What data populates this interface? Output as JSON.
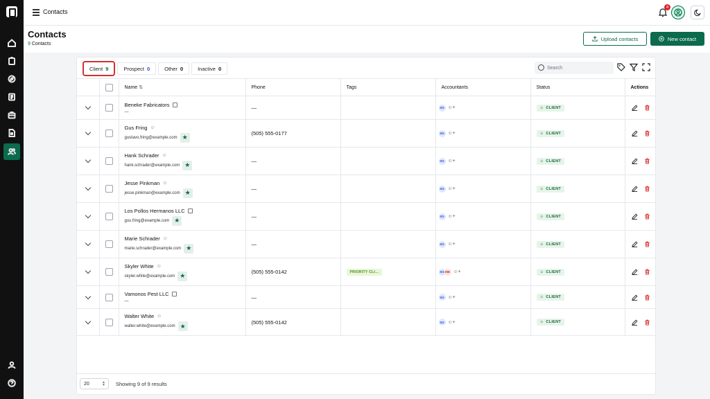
{
  "app": {
    "topbar_title": "Contacts",
    "notification_count": "4"
  },
  "header": {
    "title": "Contacts",
    "count": "9",
    "count_label": "Contacts",
    "upload_label": "Upload contacts",
    "new_label": "New contact"
  },
  "tabs": [
    {
      "label": "Client",
      "count": "9"
    },
    {
      "label": "Prospect",
      "count": "0"
    },
    {
      "label": "Other",
      "count": "0"
    },
    {
      "label": "Inactive",
      "count": "0"
    }
  ],
  "search": {
    "placeholder": "Search"
  },
  "columns": {
    "name": "Name",
    "phone": "Phone",
    "tags": "Tags",
    "accountants": "Accountants",
    "status": "Status",
    "actions": "Actions"
  },
  "rows": [
    {
      "name": "Beneke Fabricators",
      "type": "company",
      "email": "—",
      "phone": "—",
      "tag": "",
      "acc": "SG",
      "acc2": "",
      "status": "CLIENT"
    },
    {
      "name": "Gus Fring",
      "type": "person",
      "email": "gustavo.fring@example.com",
      "phone": "(505) 555-0177",
      "tag": "",
      "acc": "SG",
      "acc2": "",
      "status": "CLIENT"
    },
    {
      "name": "Hank Schrader",
      "type": "person",
      "email": "hank.schrader@example.com",
      "phone": "—",
      "tag": "",
      "acc": "SG",
      "acc2": "",
      "status": "CLIENT"
    },
    {
      "name": "Jesse Pinkman",
      "type": "person",
      "email": "jesse.pinkman@example.com",
      "phone": "—",
      "tag": "",
      "acc": "SG",
      "acc2": "",
      "status": "CLIENT"
    },
    {
      "name": "Los Pollos Hermanos LLC",
      "type": "company",
      "email": "gus.fring@example.com",
      "phone": "—",
      "tag": "",
      "acc": "SG",
      "acc2": "",
      "status": "CLIENT"
    },
    {
      "name": "Marie Schrader",
      "type": "person",
      "email": "marie.schrader@example.com",
      "phone": "—",
      "tag": "",
      "acc": "SG",
      "acc2": "",
      "status": "CLIENT"
    },
    {
      "name": "Skyler White",
      "type": "person",
      "email": "skyler.white@example.com",
      "phone": "(505) 555-0142",
      "tag": "PRIORITY CLI...",
      "acc": "SG",
      "acc2": "ME",
      "status": "CLIENT"
    },
    {
      "name": "Vamonos Pest LLC",
      "type": "company",
      "email": "—",
      "phone": "—",
      "tag": "",
      "acc": "SG",
      "acc2": "",
      "status": "CLIENT"
    },
    {
      "name": "Walter White",
      "type": "person",
      "email": "walter.white@example.com",
      "phone": "(505) 555-0142",
      "tag": "",
      "acc": "SG",
      "acc2": "",
      "status": "CLIENT"
    }
  ],
  "footer": {
    "per_page": "20",
    "showing": "Showing 9 of 9 results"
  },
  "colors": {
    "brand": "#0b6b4c",
    "sidebar": "#111111",
    "danger": "#dc2626"
  }
}
